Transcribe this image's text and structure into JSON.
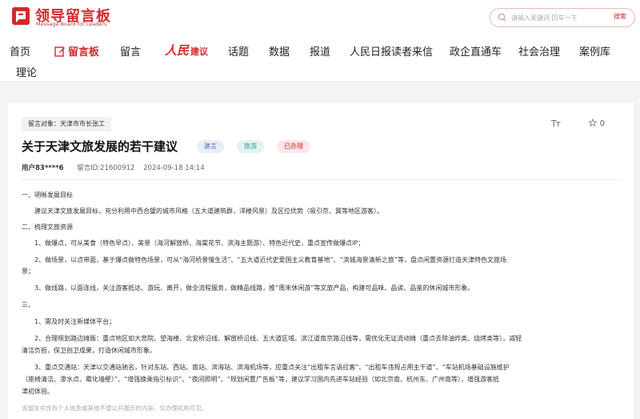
{
  "header": {
    "logo_title": "领导留言板",
    "logo_subtitle": "Message Board for Leaders",
    "search_placeholder": "请输入关键词 回车一下",
    "search_button": "搜索"
  },
  "nav": {
    "items": [
      "首页",
      "留言板",
      "留言",
      "话题",
      "数据",
      "报道",
      "人民日报读者来信",
      "政企直通车",
      "社会治理",
      "案例库",
      "理论"
    ],
    "special_a": "人民",
    "special_b": "建议",
    "active": "留言板"
  },
  "message": {
    "target": "留言对象：天津市市长张工",
    "font_tool": "Tт",
    "star_count": "0",
    "title": "关于天津文旅发展的若干建议",
    "tags": [
      "建言",
      "旅游",
      "已办理"
    ],
    "user": "用户83****6",
    "message_id": "留言ID:21600912",
    "date": "2024-09-18 14:14",
    "content": [
      "一、明晰发展目标",
      "建议天津文旅发展目标，充分利用中西合璧的城市风格（五大道建筑群，洋楼风景）及区位优势（吸引京、冀等地区游客）。",
      "二、梳理文旅资源",
      "1、做爆点，可从美食（特色早点）、美景（海河解放桥、海棠花节、滨海主题游）、特色近代史，重点宣传做爆点IP；",
      "2、做场景，以点带面，基于爆点做特色场景，可从“海河桥景慢生活”、“五大道近代史爱国主义教育基地”、“滨城海景清新之旅”等，盘点闲置资源打造天津特色文旅场",
      "景；",
      "3、做线路，以面连线，关注游客抵达、游玩、离开，做全流程服务，做精品线路，推“周末休闲游”等文旅产品，构建可品味、品读、品鉴的休闲城市形象。",
      "三、",
      "1、需及时关注新媒体平台；",
      "2、合理规划路边摊贩：重点地区如大悲院、望海楼、北安桥沿线、解放桥沿线、五大道区域、滨江道南京路沿线等，需优化无证流动摊（重点去除油炸类、烧烤类等），减轻",
      "清洁负担，保卫创卫成果，打造休闲城市形象。",
      "3、重点交通站：天津以交通站驰名，针对东站、西站、南站、滨海站、滨海机场等，应重点关注“出租车言语拉客”、“出租车违规占用主干道”、“车站机场基础设施维护",
      "（座椅清洁、渗水点、霉化墙壁）”、“增强换乘指引标识”、“夜间照明”、“规划闲置广告板”等，建议学习国内先进车站经验（如北京南、杭州东、广州南等），增强游客抵",
      "津初体验。"
    ],
    "footnote": "该留言中含有个人信息或其他不便公开展示的内容，仅办理机构可见。"
  },
  "colors": {
    "brand": "#d4282c"
  }
}
